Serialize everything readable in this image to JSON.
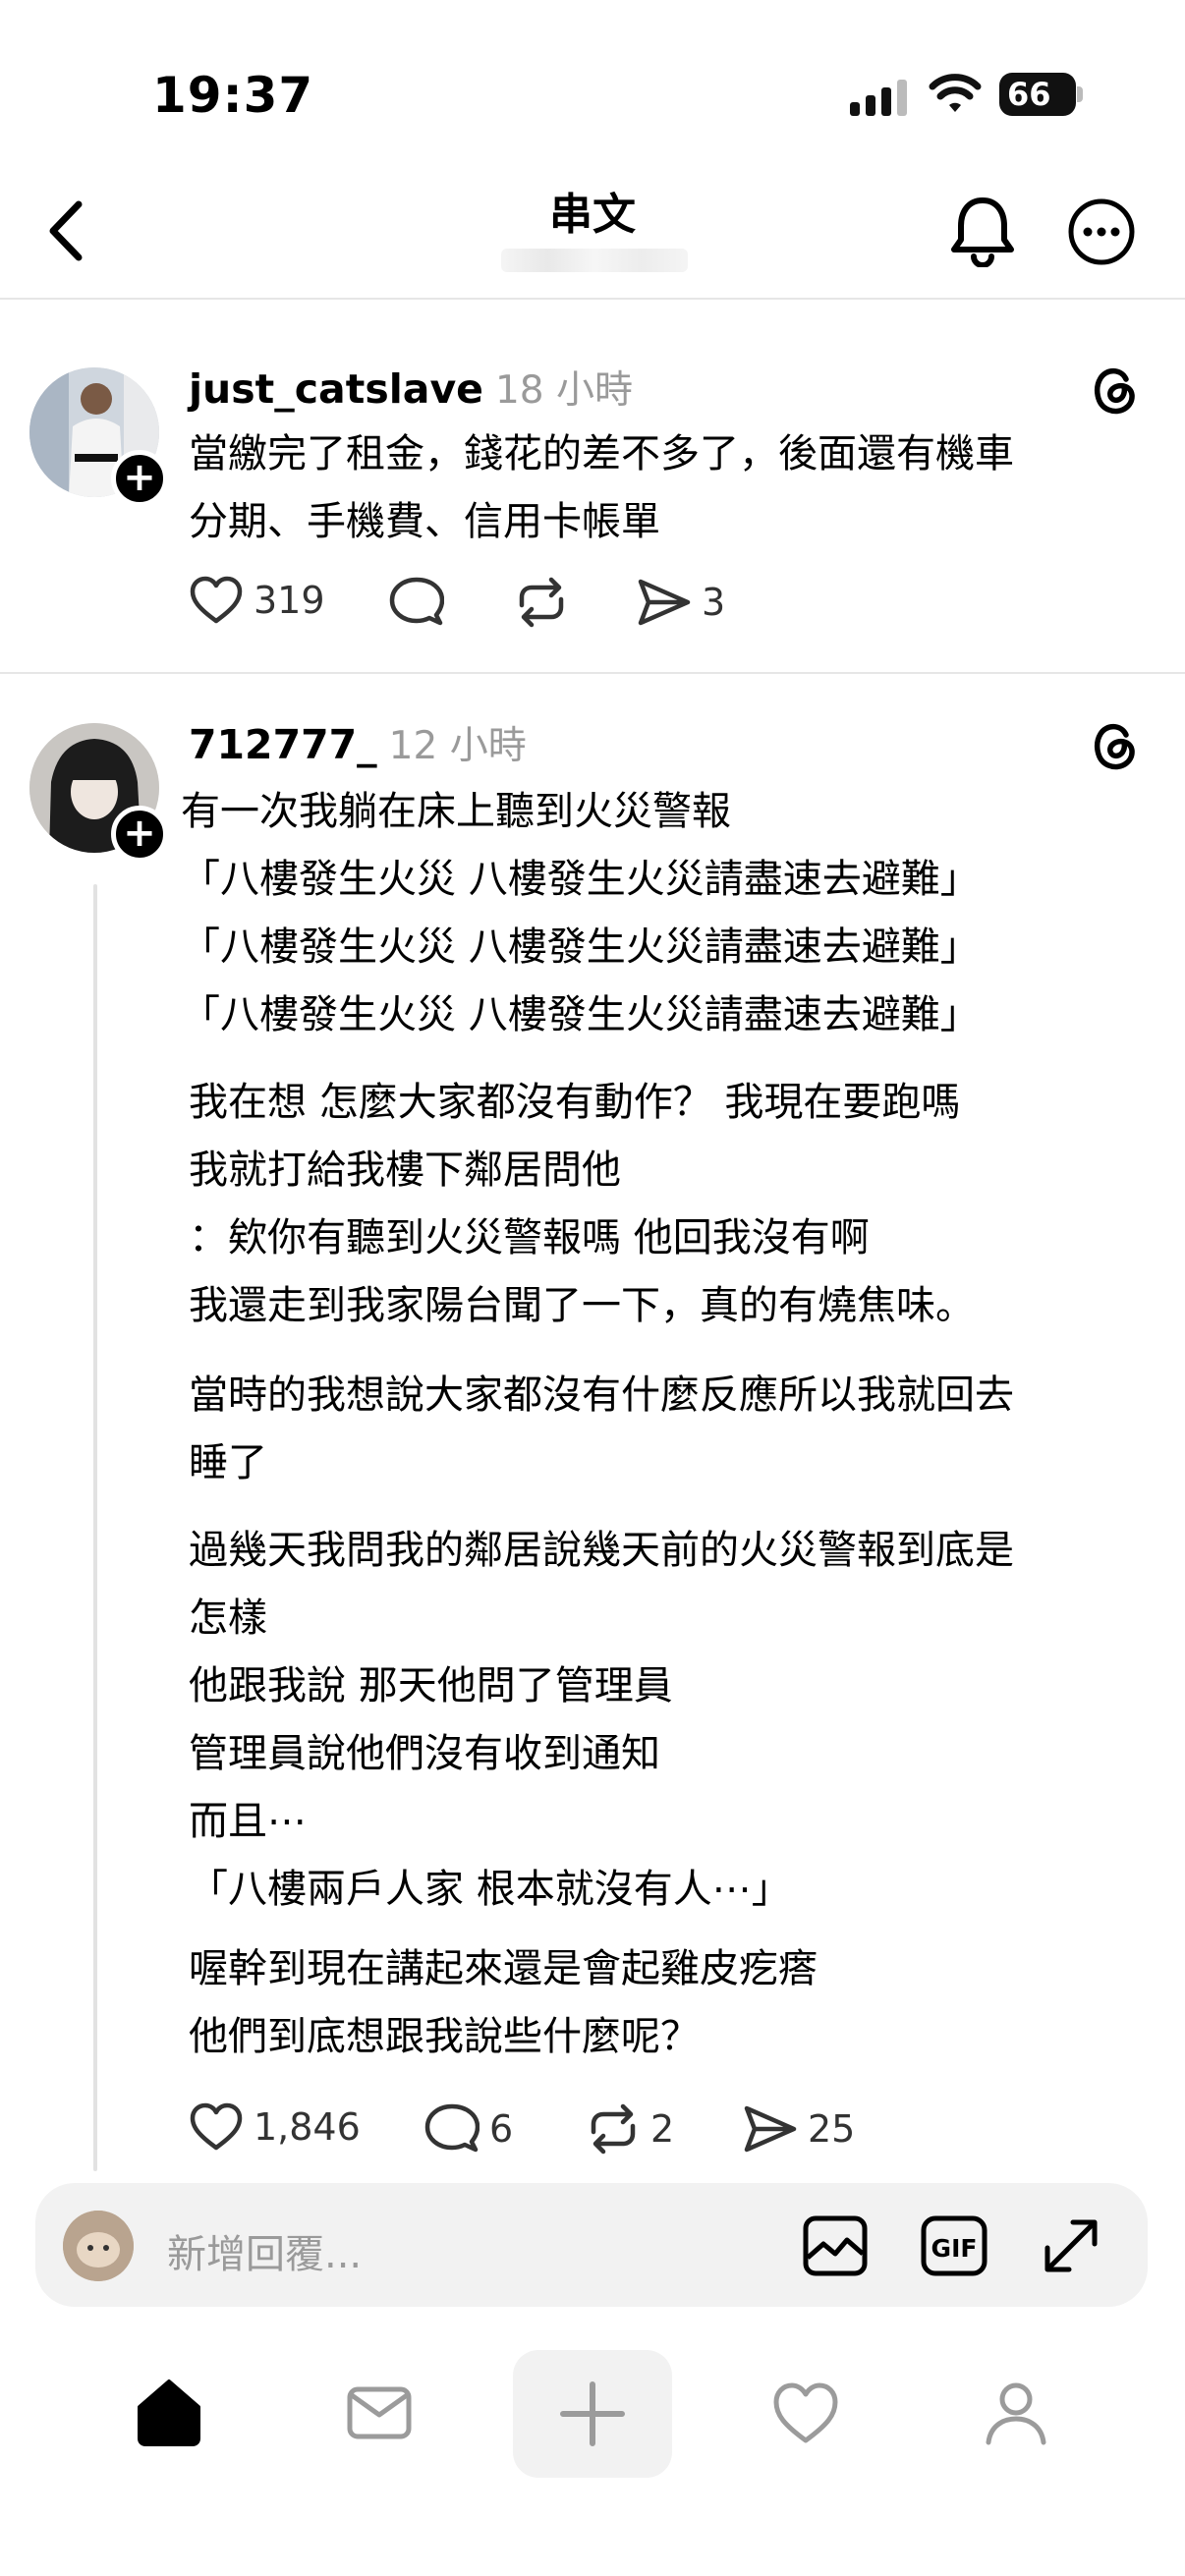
{
  "status_bar": {
    "time": "19:37",
    "battery": "66"
  },
  "header": {
    "title": "串文"
  },
  "posts": [
    {
      "username": "just_catslave",
      "time": "18 小時",
      "text": "當繳完了租金，錢花的差不多了，後面還有機車\n分期、手機費、信用卡帳單",
      "likes": "319",
      "comments": "",
      "reposts": "",
      "shares": "3"
    },
    {
      "username": "712777_",
      "time": "12 小時",
      "paragraphs": [
        "有一次我躺在床上聽到火災警報\n「八樓發生火災 八樓發生火災請盡速去避難」\n「八樓發生火災 八樓發生火災請盡速去避難」\n「八樓發生火災 八樓發生火災請盡速去避難」",
        "我在想 怎麼大家都沒有動作？ 我現在要跑嗎\n我就打給我樓下鄰居問他\n：欸你有聽到火災警報嗎 他回我沒有啊\n我還走到我家陽台聞了一下，真的有燒焦味。",
        "當時的我想說大家都沒有什麼反應所以我就回去\n睡了",
        "過幾天我問我的鄰居說幾天前的火災警報到底是\n怎樣\n他跟我說 那天他問了管理員\n管理員說他們沒有收到通知\n而且⋯\n「八樓兩戶人家 根本就沒有人⋯」",
        "喔幹到現在講起來還是會起雞皮疙瘩\n他們到底想跟我說些什麼呢？"
      ],
      "likes": "1,846",
      "comments": "6",
      "reposts": "2",
      "shares": "25"
    }
  ],
  "reply_bar": {
    "placeholder": "新增回覆..."
  },
  "icons": {
    "back": "chevron-left-icon",
    "bell": "bell-icon",
    "more": "more-icon",
    "threads": "threads-logo-icon",
    "like": "heart-icon",
    "comment": "comment-icon",
    "repost": "repost-icon",
    "share": "share-icon",
    "image": "image-icon",
    "gif": "gif-icon",
    "expand": "expand-icon",
    "home": "home-icon",
    "inbox": "inbox-icon",
    "create": "plus-icon",
    "activity": "heart-icon",
    "profile": "profile-icon"
  }
}
